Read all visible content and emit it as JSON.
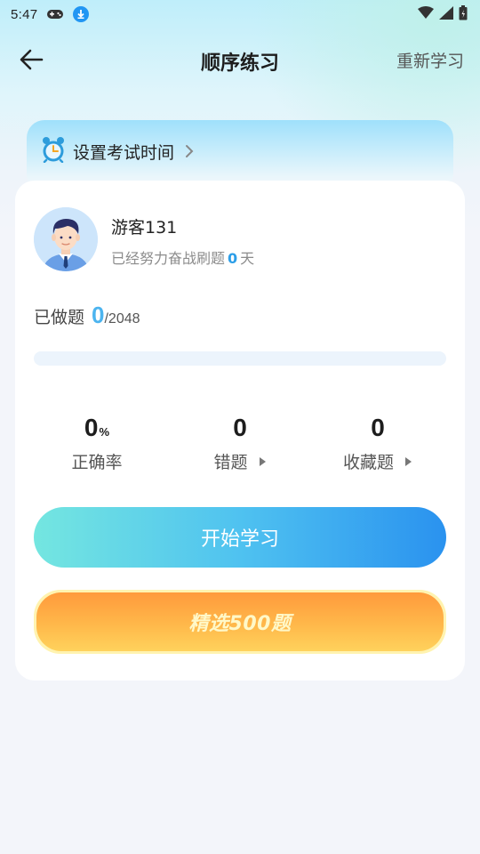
{
  "status_bar": {
    "time": "5:47",
    "icons": [
      "gamepad-icon",
      "download-icon",
      "wifi-icon",
      "signal-icon",
      "battery-icon"
    ]
  },
  "nav": {
    "back_icon": "arrow-left-icon",
    "title": "顺序练习",
    "action_label": "重新学习"
  },
  "exam_banner": {
    "icon": "alarm-clock-icon",
    "label": "设置考试时间",
    "chevron": "chevron-right-icon"
  },
  "user": {
    "name": "游客131",
    "sub_prefix": "已经努力奋战刷题",
    "days": "0",
    "sub_suffix": "天"
  },
  "progress": {
    "label": "已做题",
    "done": "0",
    "total": "/2048",
    "fraction": 0
  },
  "stats": [
    {
      "value": "0",
      "unit": "%",
      "label": "正确率"
    },
    {
      "value": "0",
      "label": "错题"
    },
    {
      "value": "0",
      "label": "收藏题"
    }
  ],
  "buttons": {
    "start": "开始学习",
    "select": "精选500题"
  },
  "colors": {
    "accent_blue": "#4cb4ef",
    "start_gradient": [
      "#74e6e0",
      "#2a92ef"
    ],
    "select_gradient": [
      "#ff9a3c",
      "#ffd25c"
    ]
  }
}
